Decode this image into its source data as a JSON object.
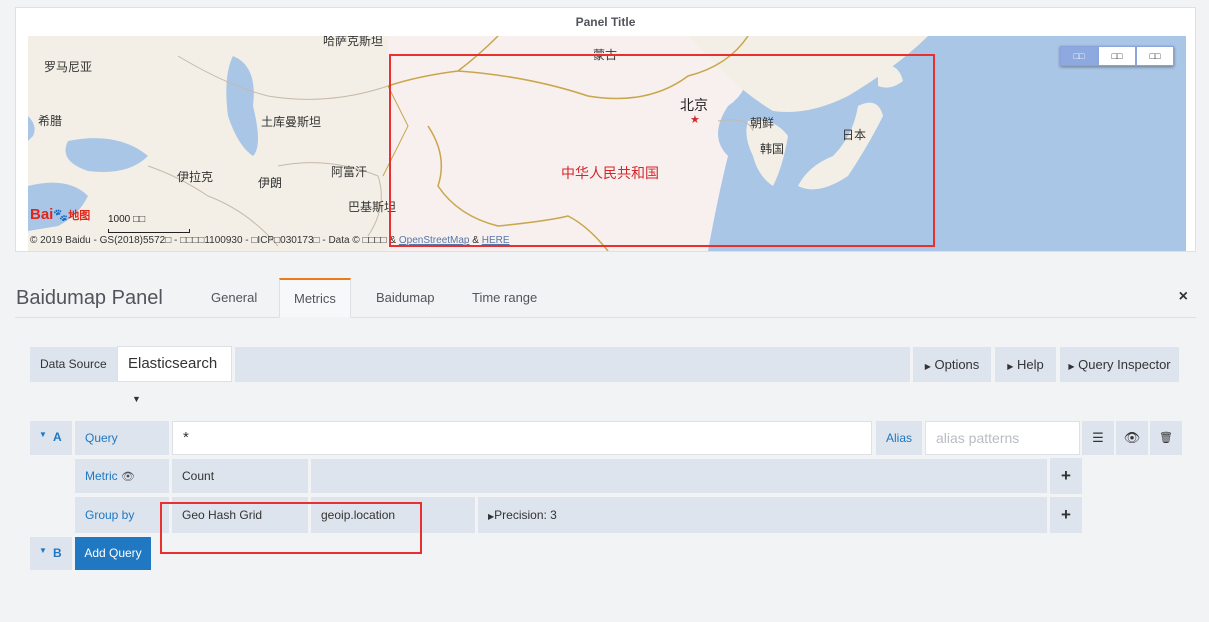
{
  "panel": {
    "title": "Panel Title"
  },
  "map": {
    "labels": {
      "romania": "罗马尼亚",
      "greece": "希腊",
      "kazakhstan": "哈萨克斯坦",
      "mongolia": "蒙古",
      "turkmenistan": "土库曼斯坦",
      "afghanistan": "阿富汗",
      "iraq": "伊拉克",
      "iran": "伊朗",
      "pakistan": "巴基斯坦",
      "china": "中华人民共和国",
      "beijing": "北京",
      "north_korea": "朝鲜",
      "south_korea": "韩国",
      "japan": "日本"
    },
    "scale_text": "1000 □□",
    "logo_text": "Bai",
    "logo_text2": "地图",
    "copyright_prefix": "© 2019 Baidu - GS(2018)5572□ - □□□□1100930 - □ICP□030173□ - Data © □□□□ & ",
    "copyright_osm": "OpenStreetMap",
    "copyright_and": " & ",
    "copyright_here": "HERE",
    "maptype_buttons": [
      "□□",
      "□□",
      "□□"
    ],
    "colors": {
      "water": "#a9c6e6",
      "land": "#f3efe6",
      "china_land": "#f7f0ee",
      "border": "#c9a64a"
    }
  },
  "editor": {
    "title": "Baidumap Panel",
    "tabs": [
      "General",
      "Metrics",
      "Baidumap",
      "Time range"
    ],
    "active_tab": "Metrics",
    "close_icon": "×"
  },
  "datasource": {
    "label": "Data Source",
    "value": "Elasticsearch"
  },
  "toolbar": {
    "options": "Options",
    "help": "Help",
    "query_inspector": "Query Inspector"
  },
  "query_a": {
    "letter": "A",
    "query_label": "Query",
    "query_value": "*",
    "alias_label": "Alias",
    "alias_placeholder": "alias patterns",
    "metric_label": "Metric",
    "metric_value": "Count",
    "group_by_label": "Group by",
    "group_by_type": "Geo Hash Grid",
    "group_by_field": "geoip.location",
    "precision": "Precision: 3"
  },
  "query_b": {
    "letter": "B",
    "add_query": "Add Query"
  },
  "colors": {
    "accent": "#1f78c1",
    "active_tab": "#eb7b18",
    "highlight": "#e8302f"
  }
}
